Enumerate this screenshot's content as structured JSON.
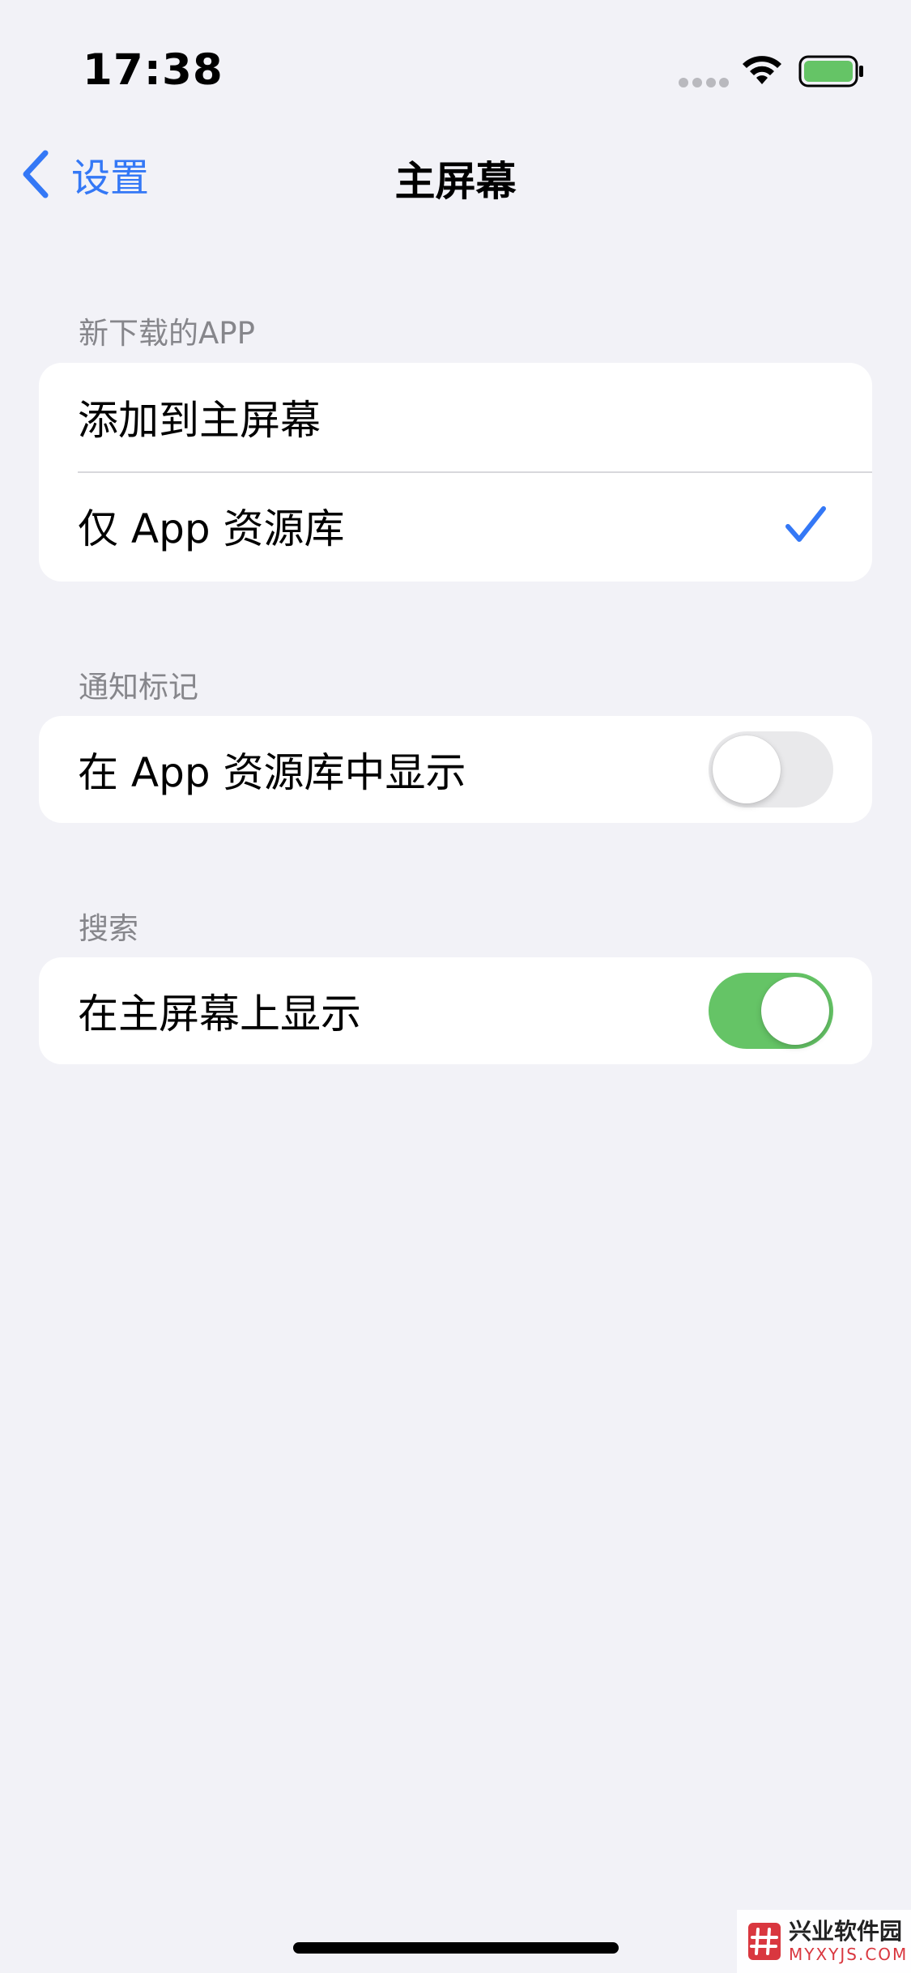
{
  "status_bar": {
    "time": "17:38",
    "icons": [
      "signal-dots-icon",
      "wifi-icon",
      "battery-icon"
    ]
  },
  "nav": {
    "back_label": "设置",
    "title": "主屏幕",
    "accent_color": "#3478f6"
  },
  "sections": [
    {
      "header": "新下载的APP",
      "rows": [
        {
          "label": "添加到主屏幕",
          "selected": false
        },
        {
          "label": "仅 App 资源库",
          "selected": true
        }
      ]
    },
    {
      "header": "通知标记",
      "rows": [
        {
          "label": "在 App 资源库中显示",
          "toggle": false
        }
      ]
    },
    {
      "header": "搜索",
      "rows": [
        {
          "label": "在主屏幕上显示",
          "toggle": true
        }
      ]
    }
  ],
  "colors": {
    "toggle_on": "#65c466",
    "toggle_off": "#e9e9eb",
    "background": "#f2f2f7"
  },
  "watermark": {
    "name": "兴业软件园",
    "url": "MYXYJS.COM"
  }
}
